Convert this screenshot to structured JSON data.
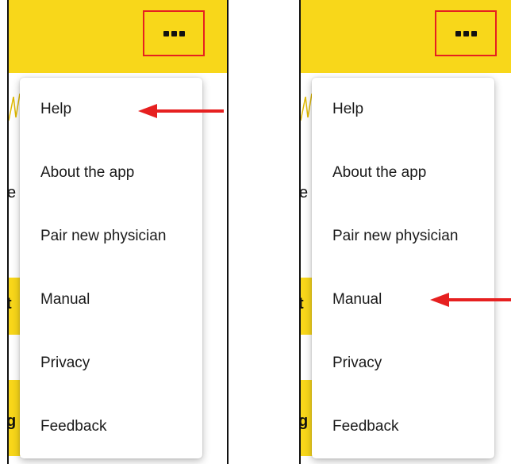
{
  "left_screen": {
    "menu_items": [
      "Help",
      "About the app",
      "Pair new physician",
      "Manual",
      "Privacy",
      "Feedback"
    ],
    "background_fragments": [
      "e",
      "t",
      "g"
    ]
  },
  "right_screen": {
    "menu_items": [
      "Help",
      "About the app",
      "Pair new physician",
      "Manual",
      "Privacy",
      "Feedback"
    ],
    "background_fragments": [
      "e",
      "t",
      "g"
    ]
  },
  "annotations": {
    "left_arrow_target": "Help",
    "right_arrow_target": "Manual",
    "highlight_color": "#e62020"
  },
  "colors": {
    "appbar": "#f8d71a",
    "accent": "#e62020"
  },
  "icons": {
    "overflow_menu": "more-horizontal-icon"
  }
}
